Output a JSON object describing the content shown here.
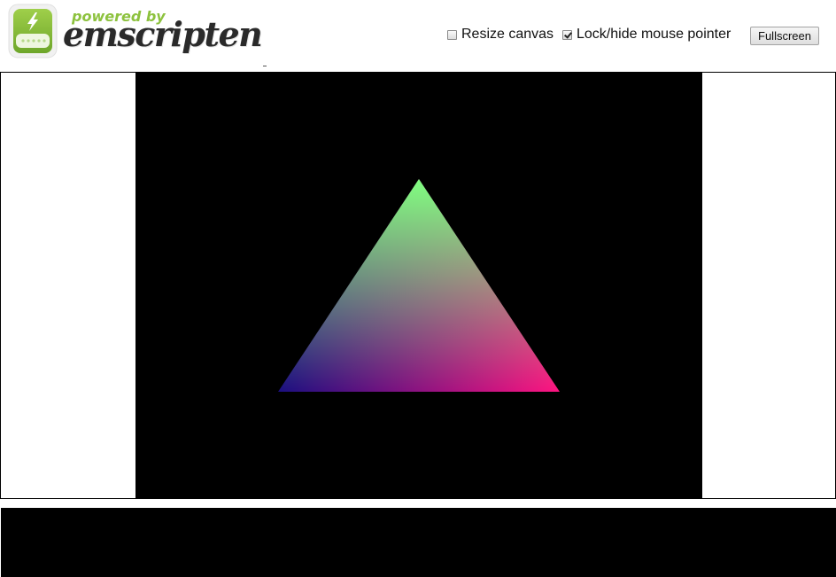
{
  "header": {
    "logo": {
      "powered_by": "powered by",
      "brand": "emscripten",
      "icon": "battery-bolt-icon"
    },
    "controls": {
      "resize_canvas": {
        "label": "Resize canvas",
        "checked": false
      },
      "lock_pointer": {
        "label": "Lock/hide mouse pointer",
        "checked": true
      }
    },
    "fullscreen_button": {
      "label": "Fullscreen"
    }
  },
  "canvas": {
    "background": "#000000",
    "triangle": {
      "top_color": "#80ff80",
      "left_color": "#1a0f80",
      "right_color": "#ff1480"
    }
  },
  "output": {
    "background": "#000000",
    "text": ""
  }
}
